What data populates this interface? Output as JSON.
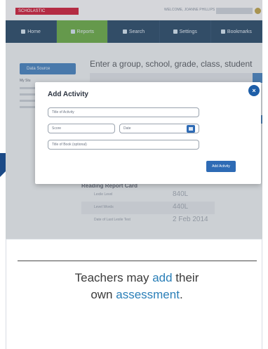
{
  "topbar": {
    "brand": "SCHOLASTIC",
    "welcome": "WELCOME, JOANNE PHILLIPS"
  },
  "nav": [
    "Home",
    "Reports",
    "Search",
    "Settings",
    "Bookmarks"
  ],
  "background": {
    "dropdown_label": "Data Source",
    "search_title": "Enter a group, school, grade, class, student",
    "my_students_label": "My Stu",
    "report_title": "Reading Report Card",
    "report_rows": [
      {
        "key": "Lexile Level",
        "value": "840L"
      },
      {
        "key": "Level Words",
        "value": "440L"
      },
      {
        "key": "Date of Last Lexile Test",
        "value": "2 Feb 2014"
      }
    ]
  },
  "modal": {
    "title": "Add Activity",
    "activity_placeholder": "Title of Activity",
    "score_placeholder": "Score",
    "date_placeholder": "Date",
    "book_placeholder": "Title of Book (optional)",
    "add_button": "Add Activity",
    "close_symbol": "×"
  },
  "caption": {
    "line1_pre": "Teachers may ",
    "line1_hl": "add",
    "line1_post": " their",
    "line2_pre": "own ",
    "line2_hl": "assessment",
    "line2_post": "."
  },
  "colors": {
    "nav_bg": "#1b3e5e",
    "nav_active": "#5fa33a",
    "accent": "#2e6bb5",
    "highlight": "#2a7fb8"
  }
}
